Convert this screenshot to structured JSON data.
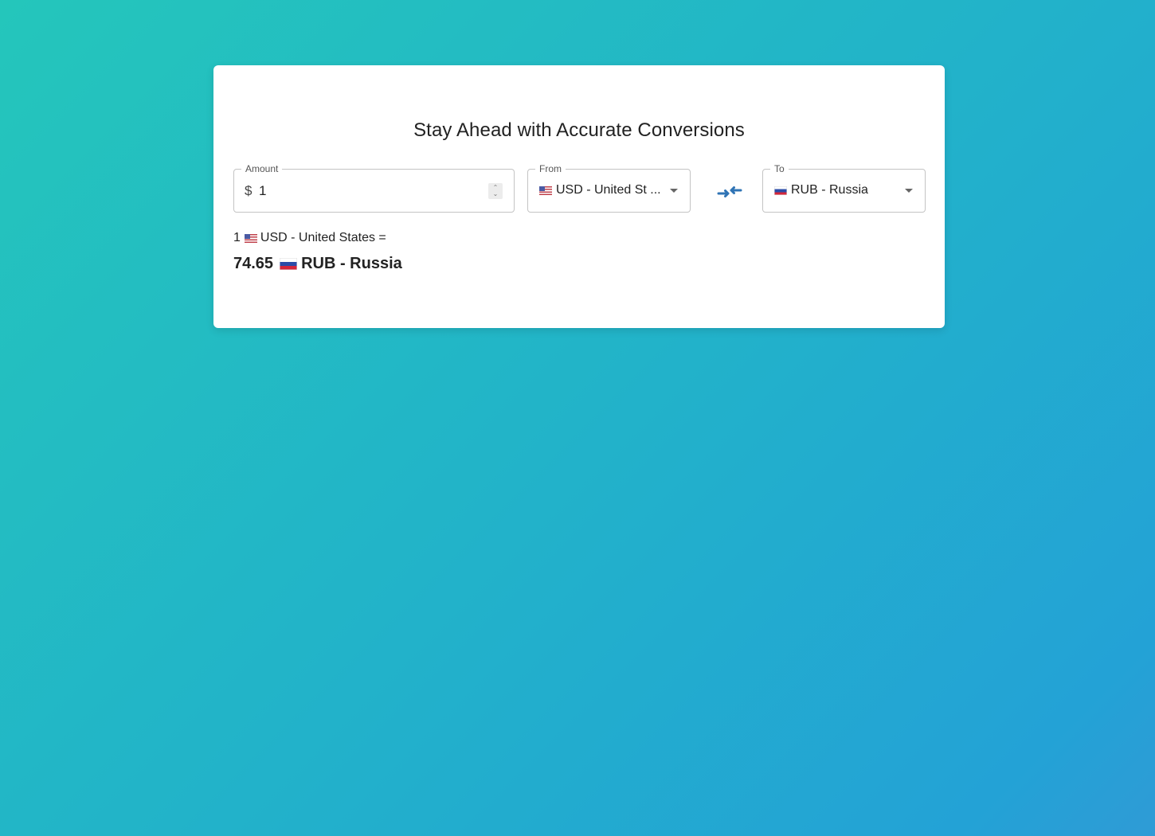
{
  "title": "Stay Ahead with Accurate Conversions",
  "amount": {
    "label": "Amount",
    "prefix": "$",
    "value": "1"
  },
  "from": {
    "label": "From",
    "flag": "us-flag-icon",
    "value": "USD - United St ..."
  },
  "to": {
    "label": "To",
    "flag": "ru-flag-icon",
    "value": "RUB - Russia"
  },
  "swap_icon": "swap-arrows-icon",
  "result": {
    "from_amount": "1",
    "from_currency": "USD - United States =",
    "to_amount": "74.65",
    "to_currency": "RUB - Russia"
  },
  "colors": {
    "background_start": "#24c6bb",
    "background_end": "#2f9bd6",
    "swap_icon": "#2f74b5"
  }
}
